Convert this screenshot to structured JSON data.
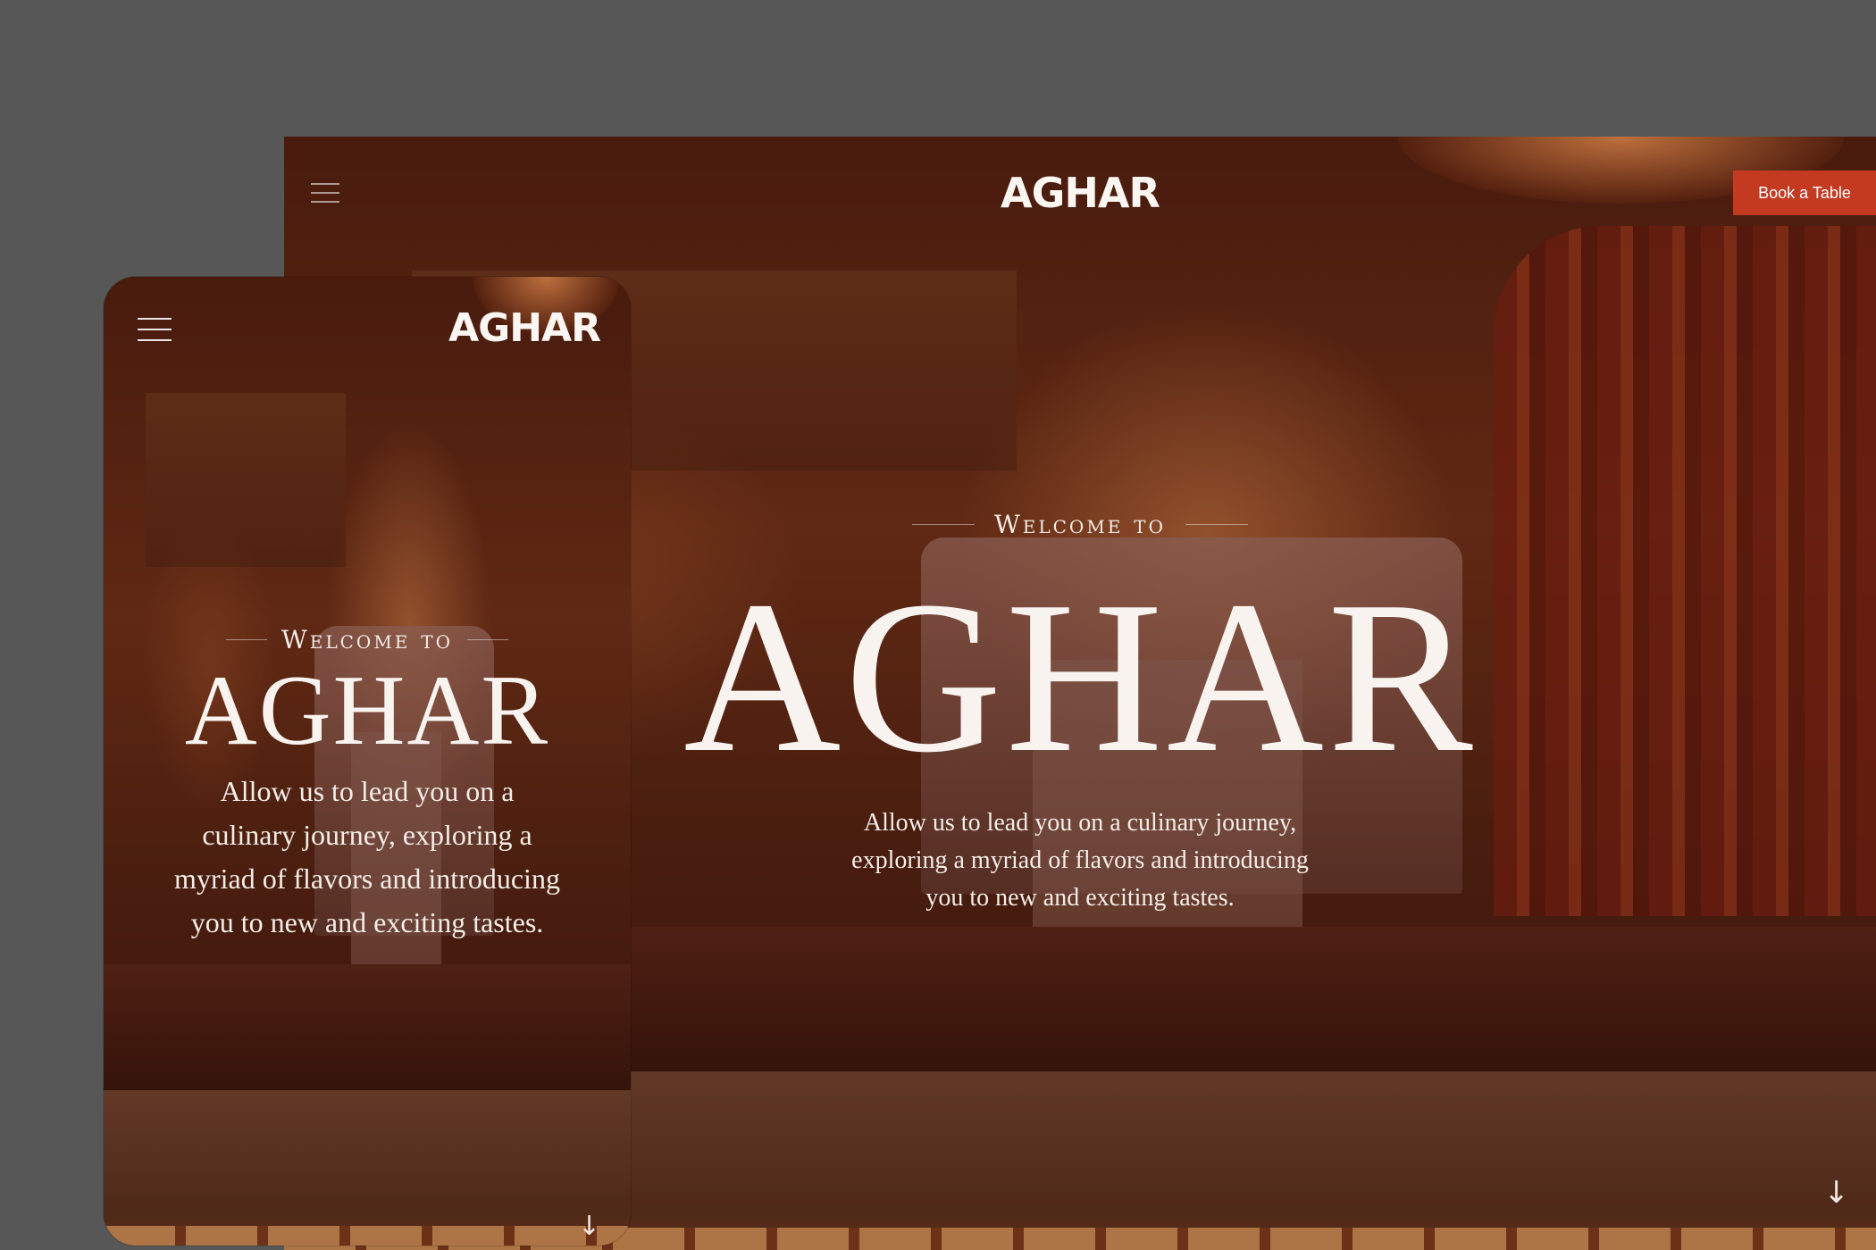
{
  "brand": {
    "logo": "AGHAR"
  },
  "desktop": {
    "book_button": "Book a Table",
    "welcome": "Welcome to",
    "title": "AGHAR",
    "tagline": "Allow us to lead you on a culinary journey, exploring a myriad of flavors and introducing you to new and exciting tastes.",
    "scroll_icon": "↓"
  },
  "mobile": {
    "welcome": "Welcome to",
    "title": "AGHAR",
    "tagline": "Allow us to lead you on a culinary journey, exploring a myriad of flavors and introducing you to new and exciting tastes.",
    "scroll_icon": "↓"
  },
  "colors": {
    "accent": "#c43a20",
    "background": "#575757",
    "text": "#f8f3ef"
  },
  "icons": {
    "menu": "hamburger-menu-icon",
    "scroll": "arrow-down-icon"
  }
}
